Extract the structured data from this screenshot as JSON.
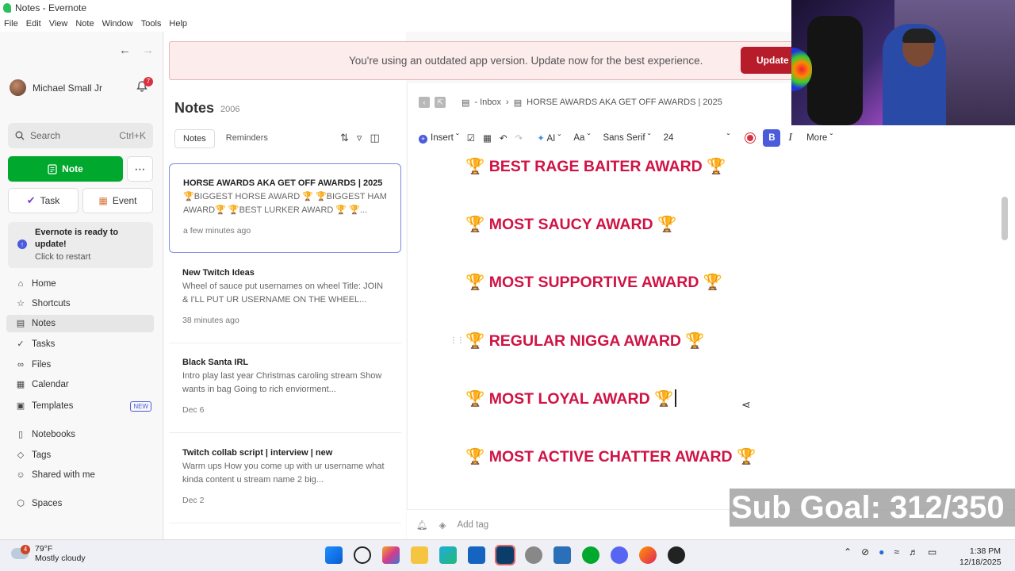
{
  "window": {
    "title": "Notes - Evernote"
  },
  "menu": [
    "File",
    "Edit",
    "View",
    "Note",
    "Window",
    "Tools",
    "Help"
  ],
  "sidebar": {
    "user_name": "Michael Small Jr",
    "notification_count": "7",
    "search_label": "Search",
    "search_shortcut": "Ctrl+K",
    "new_note_label": "Note",
    "task_label": "Task",
    "event_label": "Event",
    "update_title": "Evernote is ready to update!",
    "update_sub": "Click to restart",
    "nav": [
      {
        "label": "Home",
        "icon": "home-icon"
      },
      {
        "label": "Shortcuts",
        "icon": "star-icon"
      },
      {
        "label": "Notes",
        "icon": "notes-icon"
      },
      {
        "label": "Tasks",
        "icon": "check-circle-icon"
      },
      {
        "label": "Files",
        "icon": "paperclip-icon"
      },
      {
        "label": "Calendar",
        "icon": "calendar-icon"
      },
      {
        "label": "Templates",
        "icon": "template-icon",
        "badge": "NEW"
      },
      {
        "label": "Notebooks",
        "icon": "notebook-icon"
      },
      {
        "label": "Tags",
        "icon": "tag-icon"
      },
      {
        "label": "Shared with me",
        "icon": "people-icon"
      },
      {
        "label": "Spaces",
        "icon": "cube-icon"
      }
    ]
  },
  "notelist": {
    "title": "Notes",
    "count": "2006",
    "tabs": [
      "Notes",
      "Reminders"
    ],
    "notes": [
      {
        "title": "HORSE AWARDS AKA GET OFF AWARDS | 2025",
        "body": "🏆BIGGEST HORSE AWARD 🏆 🏆BIGGEST HAM AWARD🏆 🏆BEST LURKER AWARD 🏆 🏆...",
        "date": "a few minutes ago"
      },
      {
        "title": "New Twitch Ideas",
        "body": "Wheel of sauce put usernames on wheel Title: JOIN & I'LL PUT UR USERNAME ON THE WHEEL...",
        "date": "38 minutes ago"
      },
      {
        "title": "Black Santa IRL",
        "body": "Intro play last year Christmas caroling stream Show wants in bag Going to rich enviorment...",
        "date": "Dec 6"
      },
      {
        "title": "Twitch collab script | interview | new",
        "body": "Warm ups How you come up with ur username what kinda content u stream name 2 big...",
        "date": "Dec 2"
      }
    ]
  },
  "banner": {
    "text": "You're using an outdated app version. Update now for the best experience.",
    "button": "Update"
  },
  "editor": {
    "breadcrumb_notebook": "- Inbox",
    "breadcrumb_note": "HORSE AWARDS AKA GET OFF AWARDS | 2025",
    "toolbar": {
      "insert": "Insert",
      "ai": "AI",
      "font_size_label": "Aa",
      "font": "Sans Serif",
      "size": "24",
      "more": "More"
    },
    "lines": [
      "🏆 BEST RAGE BAITER AWARD 🏆",
      "🏆 MOST SAUCY AWARD 🏆",
      "🏆 MOST SUPPORTIVE AWARD 🏆",
      "🏆 REGULAR NIGGA AWARD 🏆",
      "🏆 MOST LOYAL AWARD 🏆",
      "🏆 MOST ACTIVE CHATTER AWARD 🏆"
    ],
    "add_tag": "Add tag",
    "text_color": "#d01345"
  },
  "overlay": {
    "sub_goal": "Sub Goal: 312/350"
  },
  "taskbar": {
    "weather_temp": "79°F",
    "weather_desc": "Mostly cloudy",
    "weather_badge": "4",
    "time": "1:38 PM",
    "date": "12/18/2025"
  }
}
